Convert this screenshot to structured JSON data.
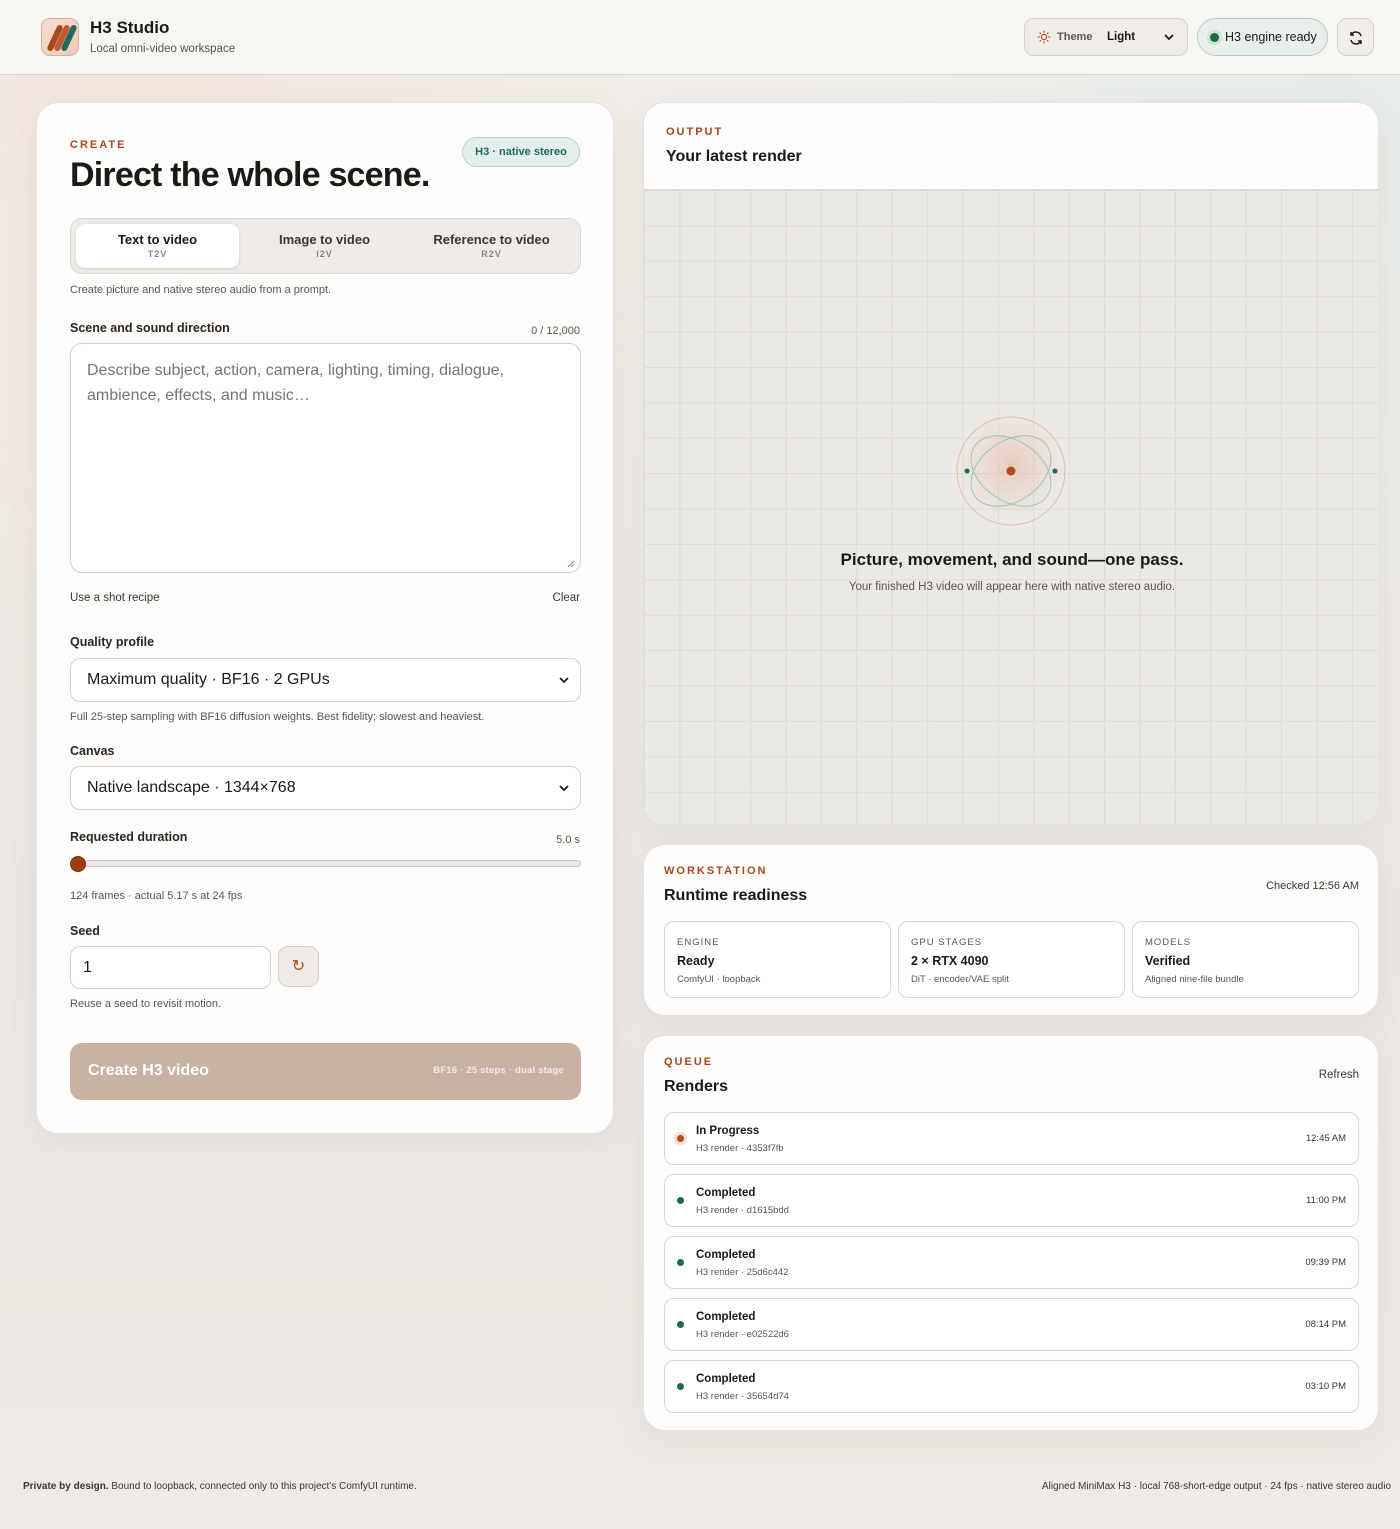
{
  "header": {
    "app_title": "H3 Studio",
    "app_subtitle": "Local omni-video workspace",
    "theme_label": "Theme",
    "theme_value": "Light",
    "engine_status": "H3 engine ready"
  },
  "create": {
    "eyebrow": "CREATE",
    "headline": "Direct the whole scene.",
    "badge": "H3 · native stereo",
    "tabs": [
      {
        "label": "Text to video",
        "code": "T2V"
      },
      {
        "label": "Image to video",
        "code": "I2V"
      },
      {
        "label": "Reference to video",
        "code": "R2V"
      }
    ],
    "mode_hint": "Create picture and native stereo audio from a prompt.",
    "prompt_label": "Scene and sound direction",
    "prompt_counter": "0 / 12,000",
    "prompt_placeholder": "Describe subject, action, camera, lighting, timing, dialogue, ambience, effects, and music…",
    "shot_recipe_link": "Use a shot recipe",
    "clear_link": "Clear",
    "quality_label": "Quality profile",
    "quality_value": "Maximum quality · BF16 · 2 GPUs",
    "quality_hint": "Full 25-step sampling with BF16 diffusion weights. Best fidelity; slowest and heaviest.",
    "canvas_label": "Canvas",
    "canvas_value": "Native landscape · 1344×768",
    "duration_label": "Requested duration",
    "duration_value": "5.0 s",
    "duration_fraction": 0.0,
    "duration_hint": "124 frames · actual 5.17 s at 24 fps",
    "seed_label": "Seed",
    "seed_value": "1",
    "seed_hint": "Reuse a seed to revisit motion.",
    "submit_label": "Create H3 video",
    "submit_meta": "BF16 · 25 steps · dual stage"
  },
  "output": {
    "eyebrow": "OUTPUT",
    "title": "Your latest render",
    "empty_title": "Picture, movement, and sound—one pass.",
    "empty_subtitle": "Your finished H3 video will appear here with native stereo audio."
  },
  "workstation": {
    "eyebrow": "WORKSTATION",
    "title": "Runtime readiness",
    "checked": "Checked 12:56 AM",
    "stats": [
      {
        "key": "ENGINE",
        "value": "Ready",
        "detail": "ComfyUI · loopback"
      },
      {
        "key": "GPU STAGES",
        "value": "2 × RTX 4090",
        "detail": "DiT · encoder/VAE split"
      },
      {
        "key": "MODELS",
        "value": "Verified",
        "detail": "Aligned nine-file bundle"
      }
    ]
  },
  "queue": {
    "eyebrow": "QUEUE",
    "title": "Renders",
    "refresh_label": "Refresh",
    "items": [
      {
        "status": "In Progress",
        "id": "H3 render · 4353f7fb",
        "time": "12:45 AM",
        "state": "progress"
      },
      {
        "status": "Completed",
        "id": "H3 render · d1615bdd",
        "time": "11:00 PM",
        "state": "done"
      },
      {
        "status": "Completed",
        "id": "H3 render · 25d6c442",
        "time": "09:39 PM",
        "state": "done"
      },
      {
        "status": "Completed",
        "id": "H3 render · e02522d6",
        "time": "08:14 PM",
        "state": "done"
      },
      {
        "status": "Completed",
        "id": "H3 render · 35654d74",
        "time": "03:10 PM",
        "state": "done"
      }
    ]
  },
  "footer": {
    "privacy_bold": "Private by design.",
    "privacy_text": " Bound to loopback, connected only to this project's ComfyUI runtime.",
    "right_text": "Aligned MiniMax H3 · local 768-short-edge output · 24 fps · native stereo audio"
  },
  "colors": {
    "accent": "#a8461c",
    "teal": "#1f6b5b",
    "success": "#1f6b43",
    "button_disabled": "#c9b1a3"
  }
}
